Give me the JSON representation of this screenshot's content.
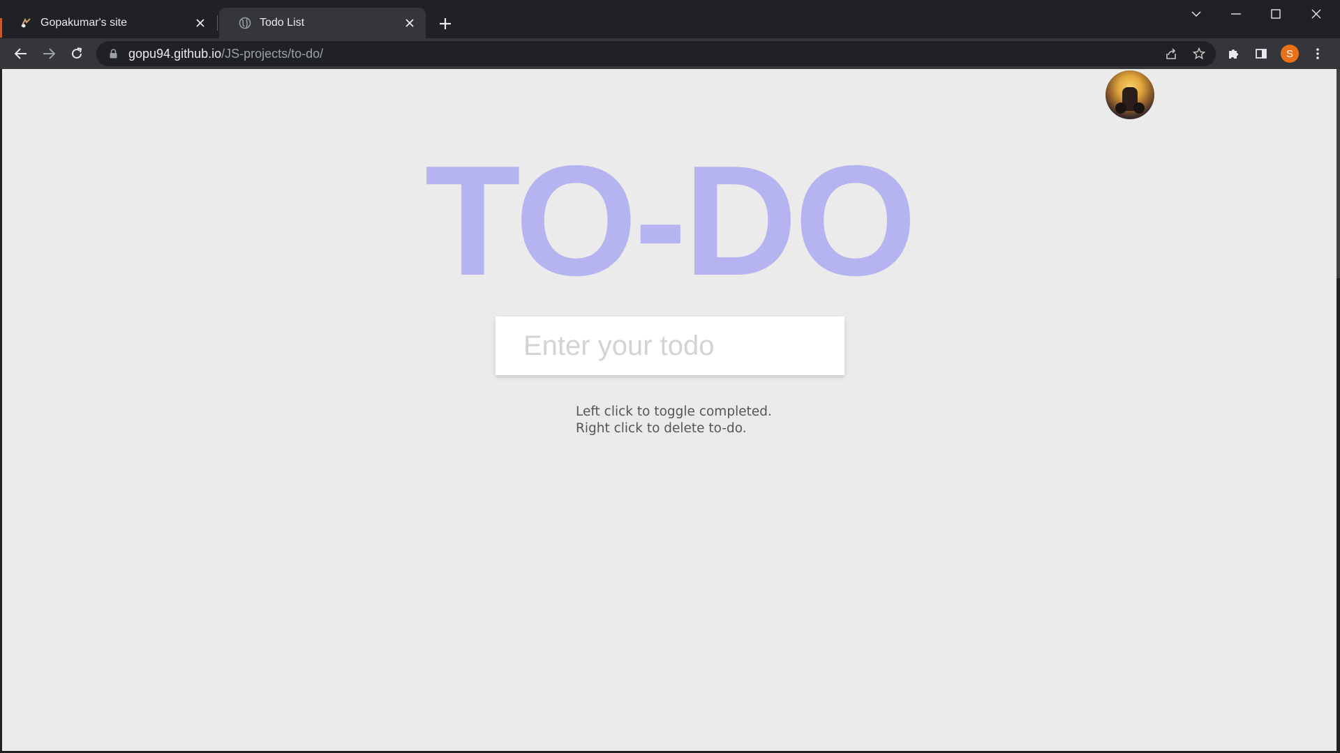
{
  "browser": {
    "tabs": [
      {
        "title": "Gopakumar's site",
        "active": false
      },
      {
        "title": "Todo List",
        "active": true
      }
    ],
    "omnibox": {
      "host": "gopu94.github.io",
      "path": "/JS-projects/to-do/"
    },
    "profile_initial": "S",
    "profile_color": "#e8711a"
  },
  "page": {
    "heading": "TO-DO",
    "heading_color": "#b5b4f0",
    "input": {
      "placeholder": "Enter your todo",
      "value": ""
    },
    "hints": [
      "Left click to toggle completed.",
      "Right click to delete to-do."
    ],
    "background_color": "#ebebeb"
  }
}
